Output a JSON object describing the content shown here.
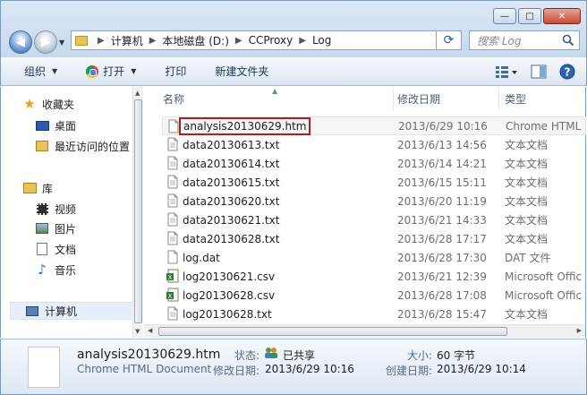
{
  "window": {
    "min_label": "—",
    "max_label": "□",
    "close_label": "✕"
  },
  "address": {
    "crumbs": [
      "计算机",
      "本地磁盘 (D:)",
      "CCProxy",
      "Log"
    ],
    "refresh_glyph": "⟳"
  },
  "search": {
    "placeholder": "搜索 Log"
  },
  "toolbar": {
    "organize": "组织",
    "open": "打开",
    "print": "打印",
    "new_folder": "新建文件夹"
  },
  "nav": {
    "favorites": "收藏夹",
    "desktop": "桌面",
    "recent": "最近访问的位置",
    "libraries": "库",
    "videos": "视频",
    "pictures": "图片",
    "documents": "文档",
    "music": "音乐",
    "computer": "计算机"
  },
  "columns": {
    "name": "名称",
    "date": "修改日期",
    "type": "类型"
  },
  "files": [
    {
      "name": "analysis20130629.htm",
      "date": "2013/6/29 10:16",
      "type": "Chrome HTML",
      "icon": "html-file-icon"
    },
    {
      "name": "data20130613.txt",
      "date": "2013/6/13 14:56",
      "type": "文本文档",
      "icon": "text-file-icon"
    },
    {
      "name": "data20130614.txt",
      "date": "2013/6/14 14:21",
      "type": "文本文档",
      "icon": "text-file-icon"
    },
    {
      "name": "data20130615.txt",
      "date": "2013/6/15 15:11",
      "type": "文本文档",
      "icon": "text-file-icon"
    },
    {
      "name": "data20130620.txt",
      "date": "2013/6/20 11:19",
      "type": "文本文档",
      "icon": "text-file-icon"
    },
    {
      "name": "data20130621.txt",
      "date": "2013/6/21 14:33",
      "type": "文本文档",
      "icon": "text-file-icon"
    },
    {
      "name": "data20130628.txt",
      "date": "2013/6/28 17:17",
      "type": "文本文档",
      "icon": "text-file-icon"
    },
    {
      "name": "log.dat",
      "date": "2013/6/28 17:30",
      "type": "DAT 文件",
      "icon": "dat-file-icon"
    },
    {
      "name": "log20130621.csv",
      "date": "2013/6/21 12:39",
      "type": "Microsoft Offic",
      "icon": "excel-file-icon"
    },
    {
      "name": "log20130628.csv",
      "date": "2013/6/28 17:08",
      "type": "Microsoft Offic",
      "icon": "excel-file-icon"
    },
    {
      "name": "log20130628.txt",
      "date": "2013/6/28 15:47",
      "type": "文本文档",
      "icon": "text-file-icon"
    }
  ],
  "details": {
    "name": "analysis20130629.htm",
    "type": "Chrome HTML Document",
    "status_label": "状态:",
    "status_value": "已共享",
    "modified_label": "修改日期:",
    "modified_value": "2013/6/29 10:16",
    "size_label": "大小:",
    "size_value": "60 字节",
    "created_label": "创建日期:",
    "created_value": "2013/6/29 10:14"
  }
}
